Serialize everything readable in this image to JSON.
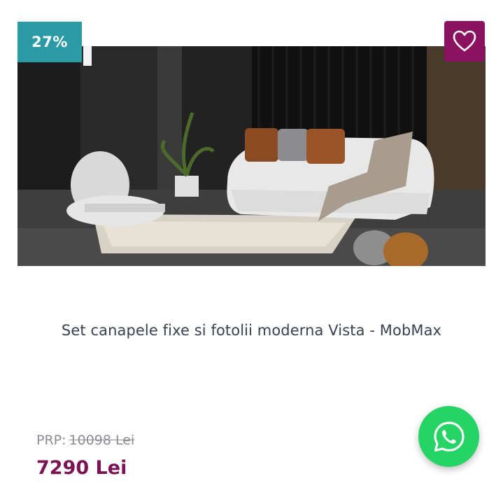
{
  "badge": {
    "discount": "27%"
  },
  "wishlist": {
    "icon": "heart-outline-icon"
  },
  "product": {
    "image_alt": "Set canapele fixe si fotolii moderna Vista - MobMax",
    "title": "Set canapele fixe si fotolii moderna Vista - MobMax"
  },
  "price": {
    "old_label": "PRP:",
    "old_value": "10098 Lei",
    "current": "7290 Lei"
  },
  "whatsapp": {
    "icon": "whatsapp-icon"
  },
  "colors": {
    "badge_bg": "#2a9aa6",
    "wishlist_bg": "#8a1260",
    "price_current": "#7a1254",
    "whatsapp_bg": "#26d466"
  }
}
